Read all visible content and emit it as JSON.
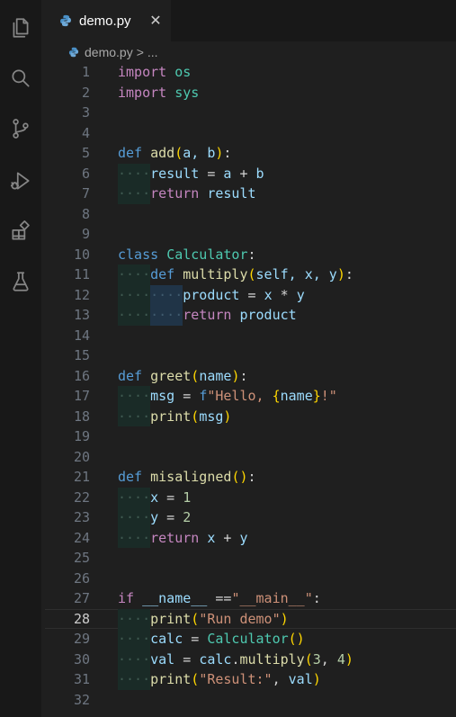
{
  "activity_bar": {
    "icons": [
      "explorer-icon",
      "search-icon",
      "source-control-icon",
      "run-debug-icon",
      "extensions-icon",
      "testing-icon"
    ]
  },
  "tab": {
    "title": "demo.py",
    "close": "✕"
  },
  "breadcrumb": {
    "file": "demo.py",
    "separator": ">",
    "more": "..."
  },
  "editor": {
    "current_line": 28,
    "lines": [
      {
        "n": "1"
      },
      {
        "n": "2"
      },
      {
        "n": "3"
      },
      {
        "n": "4"
      },
      {
        "n": "5"
      },
      {
        "n": "6"
      },
      {
        "n": "7"
      },
      {
        "n": "8"
      },
      {
        "n": "9"
      },
      {
        "n": "10"
      },
      {
        "n": "11"
      },
      {
        "n": "12"
      },
      {
        "n": "13"
      },
      {
        "n": "14"
      },
      {
        "n": "15"
      },
      {
        "n": "16"
      },
      {
        "n": "17"
      },
      {
        "n": "18"
      },
      {
        "n": "19"
      },
      {
        "n": "20"
      },
      {
        "n": "21"
      },
      {
        "n": "22"
      },
      {
        "n": "23"
      },
      {
        "n": "24"
      },
      {
        "n": "25"
      },
      {
        "n": "26"
      },
      {
        "n": "27"
      },
      {
        "n": "28"
      },
      {
        "n": "29"
      },
      {
        "n": "30"
      },
      {
        "n": "31"
      },
      {
        "n": "32"
      }
    ],
    "code": {
      "l1": [
        "import",
        "os"
      ],
      "l2": [
        "import",
        "sys"
      ],
      "l5": [
        "def",
        "add",
        "(",
        "a, b",
        ")",
        ":"
      ],
      "l6": [
        "result",
        " = ",
        "a",
        " + ",
        "b"
      ],
      "l7": [
        "return",
        "result"
      ],
      "l10": [
        "class",
        "Calculator",
        ":"
      ],
      "l11": [
        "def",
        "multiply",
        "(",
        "self, x, y",
        ")",
        ":"
      ],
      "l12": [
        "product",
        " = ",
        "x",
        " * ",
        "y"
      ],
      "l13": [
        "return",
        "product"
      ],
      "l16": [
        "def",
        "greet",
        "(",
        "name",
        ")",
        ":"
      ],
      "l17": [
        "msg",
        " = ",
        "f",
        "\"Hello, ",
        "{",
        "name",
        "}",
        "!\""
      ],
      "l18": [
        "print",
        "(",
        "msg",
        ")"
      ],
      "l21": [
        "def",
        "misaligned",
        "()",
        ":"
      ],
      "l22": [
        "x",
        " = ",
        "1"
      ],
      "l23": [
        "y",
        " = ",
        "2"
      ],
      "l24": [
        "return",
        "x",
        " + ",
        "y"
      ],
      "l27": [
        "if",
        "__name__",
        " ==",
        "\"__main__\"",
        ":"
      ],
      "l28": [
        "print",
        "(",
        "\"Run demo\"",
        ")"
      ],
      "l29": [
        "calc",
        " = ",
        "Calculator",
        "()"
      ],
      "l30": [
        "val",
        " = ",
        "calc",
        ".",
        "multiply",
        "(",
        "3",
        ", ",
        "4",
        ")"
      ],
      "l31": [
        "print",
        "(",
        "\"Result:\"",
        ", ",
        "val",
        ")"
      ]
    }
  },
  "colors": {
    "background": "#1f1f1f",
    "keyword": "#569cd6",
    "control": "#c586c0",
    "function": "#dcdcaa",
    "class": "#4ec9b0",
    "variable": "#9cdcfe",
    "string": "#ce9178",
    "number": "#b5cea8"
  }
}
